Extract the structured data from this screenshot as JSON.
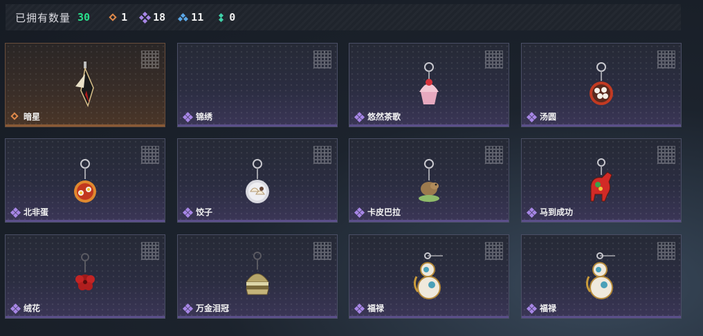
{
  "header": {
    "owned_label": "已拥有数量",
    "owned_count": "30",
    "rarities": [
      {
        "icon": "orange-diamond-icon",
        "color": "#e0894a",
        "count": "1"
      },
      {
        "icon": "purple-quad-diamond-icon",
        "color": "#a786e6",
        "count": "18"
      },
      {
        "icon": "blue-tri-diamond-icon",
        "color": "#5aa6e6",
        "count": "11"
      },
      {
        "icon": "green-dots-icon",
        "color": "#3fd1a8",
        "count": "0"
      }
    ]
  },
  "items": [
    {
      "name": "暗星",
      "rarity": "gold",
      "icon": "dark-star-blade-charm-icon"
    },
    {
      "name": "锦绣",
      "rarity": "purple",
      "icon": "empty-charm-icon"
    },
    {
      "name": "悠然茶歌",
      "rarity": "purple",
      "icon": "cupcake-charm-icon"
    },
    {
      "name": "汤圆",
      "rarity": "purple",
      "icon": "tangyuan-bowl-charm-icon"
    },
    {
      "name": "北非蛋",
      "rarity": "purple",
      "icon": "shakshuka-charm-icon"
    },
    {
      "name": "饺子",
      "rarity": "purple",
      "icon": "dumpling-plate-charm-icon"
    },
    {
      "name": "卡皮巴拉",
      "rarity": "purple",
      "icon": "capybara-charm-icon"
    },
    {
      "name": "马到成功",
      "rarity": "purple",
      "icon": "red-horse-charm-icon"
    },
    {
      "name": "绒花",
      "rarity": "purple",
      "icon": "red-flower-charm-icon"
    },
    {
      "name": "万金泪冠",
      "rarity": "purple",
      "icon": "golden-burger-charm-icon"
    },
    {
      "name": "福禄",
      "rarity": "purple",
      "icon": "gourd-charm-icon"
    },
    {
      "name": "福禄",
      "rarity": "purple",
      "icon": "gourd-charm-icon"
    }
  ]
}
